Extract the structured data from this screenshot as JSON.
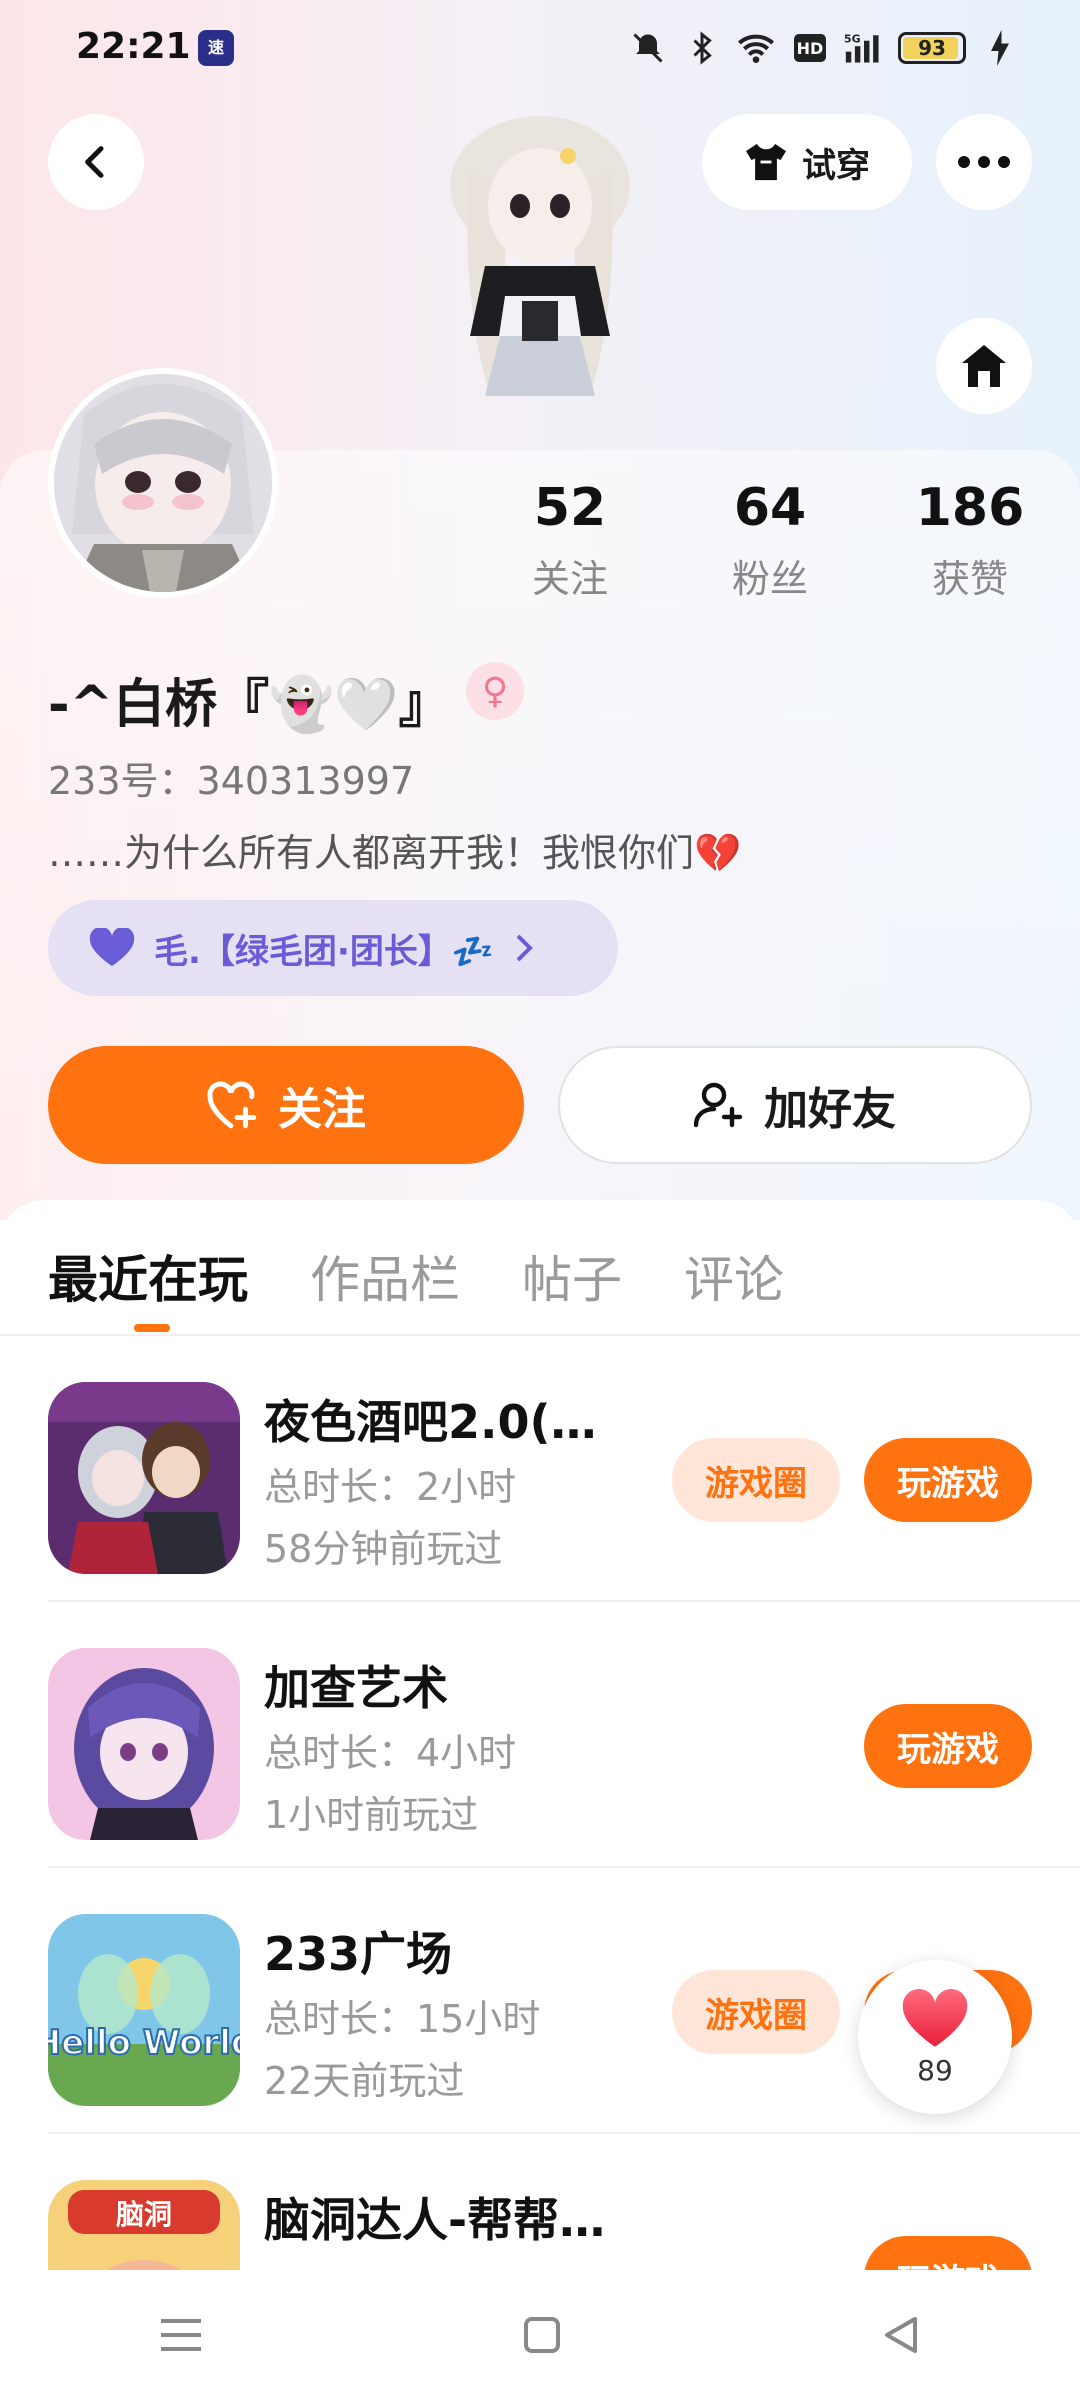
{
  "status_bar": {
    "time": "22:21",
    "app_badge": "速",
    "battery": "93",
    "network": "5G"
  },
  "header": {
    "try_on_label": "试穿"
  },
  "stats": [
    {
      "value": "52",
      "label": "关注"
    },
    {
      "value": "64",
      "label": "粉丝"
    },
    {
      "value": "186",
      "label": "获赞"
    }
  ],
  "profile": {
    "username": "-^白桥『👻🤍』",
    "uid": "233号：340313997",
    "bio": "……为什么所有人都离开我！我恨你们💔",
    "guild": "毛.【绿毛团·团长】💤"
  },
  "actions": {
    "follow": "关注",
    "add_friend": "加好友"
  },
  "tabs": [
    "最近在玩",
    "作品栏",
    "帖子",
    "评论"
  ],
  "games": [
    {
      "name": "夜色酒吧2.0(测...",
      "duration": "总时长：2小时",
      "last_played": "58分钟前玩过",
      "circle_label": "游戏圈",
      "play_label": "玩游戏"
    },
    {
      "name": "加查艺术",
      "duration": "总时长：4小时",
      "last_played": "1小时前玩过",
      "circle_label": "",
      "play_label": "玩游戏"
    },
    {
      "name": "233广场",
      "duration": "总时长：15小时",
      "last_played": "22天前玩过",
      "circle_label": "游戏圈",
      "play_label": "玩游戏",
      "icon_text": "Hello World"
    },
    {
      "name": "脑洞达人-帮帮姐姐",
      "duration": "",
      "last_played": "",
      "circle_label": "",
      "play_label": "玩游戏",
      "icon_text": "脑洞"
    }
  ],
  "like_float": {
    "count": "89"
  },
  "colors": {
    "accent": "#ff7210",
    "guild_bg": "#e6e0f5",
    "guild_text": "#6a5bd6"
  }
}
